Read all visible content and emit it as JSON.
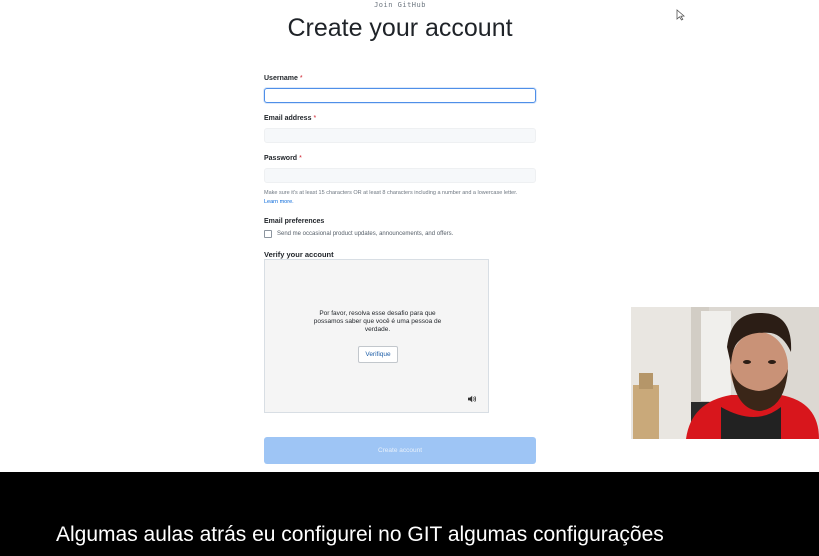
{
  "header": {
    "join_label": "Join GitHub",
    "title": "Create your account"
  },
  "form": {
    "username_label": "Username",
    "email_label": "Email address",
    "password_label": "Password",
    "required_mark": "*",
    "password_hint": "Make sure it's at least 15 characters OR at least 8 characters including a number and a lowercase letter.",
    "learn_more": "Learn more.",
    "email_prefs_label": "Email preferences",
    "email_prefs_checkbox": "Send me occasional product updates, announcements, and offers.",
    "email_prefs_checked": false,
    "verify_title": "Verify your account"
  },
  "captcha": {
    "text": "Por favor, resolva esse desafio para que possamos saber que você é uma pessoa de verdade.",
    "button": "Verifique",
    "icon": "speaker-icon"
  },
  "submit": {
    "label": "Create account"
  },
  "subtitle": {
    "text": "Algumas aulas atrás eu configurei no GIT algumas configurações"
  },
  "colors": {
    "focus_border": "#4f8fe8",
    "button_disabled": "#9ec5f5",
    "required": "#cf222e",
    "link": "#0969da"
  }
}
